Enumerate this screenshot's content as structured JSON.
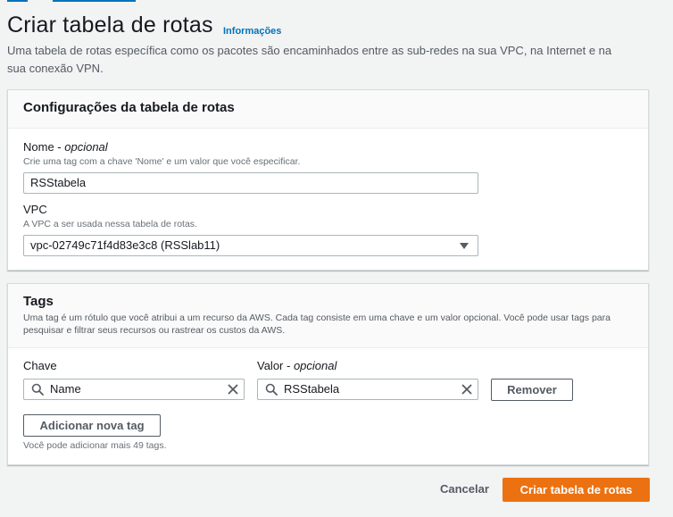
{
  "header": {
    "title": "Criar tabela de rotas",
    "info_link": "Informações",
    "description": "Uma tabela de rotas específica como os pacotes são encaminhados entre as sub-redes na sua VPC, na Internet e na sua conexão VPN."
  },
  "route_table_settings": {
    "title": "Configurações da tabela de rotas",
    "name": {
      "label": "Nome",
      "optional": "opcional",
      "hint": "Crie uma tag com a chave 'Nome' e um valor que você especificar.",
      "value": "RSStabela"
    },
    "vpc": {
      "label": "VPC",
      "hint": "A VPC a ser usada nessa tabela de rotas.",
      "selected": "vpc-02749c71f4d83e3c8 (RSSlab11)"
    }
  },
  "tags": {
    "title": "Tags",
    "description": "Uma tag é um rótulo que você atribui a um recurso da AWS. Cada tag consiste em uma chave e um valor opcional. Você pode usar tags para pesquisar e filtrar seus recursos ou rastrear os custos da AWS.",
    "key_label": "Chave",
    "value_label": "Valor",
    "value_optional": "opcional",
    "rows": [
      {
        "key": "Name",
        "value": "RSStabela"
      }
    ],
    "remove_label": "Remover",
    "add_label": "Adicionar nova tag",
    "limit_text": "Você pode adicionar mais 49 tags."
  },
  "footer": {
    "cancel_label": "Cancelar",
    "submit_label": "Criar tabela de rotas"
  },
  "colors": {
    "primary": "#ec7211",
    "link": "#0073bb",
    "background": "#f2f3f3"
  }
}
